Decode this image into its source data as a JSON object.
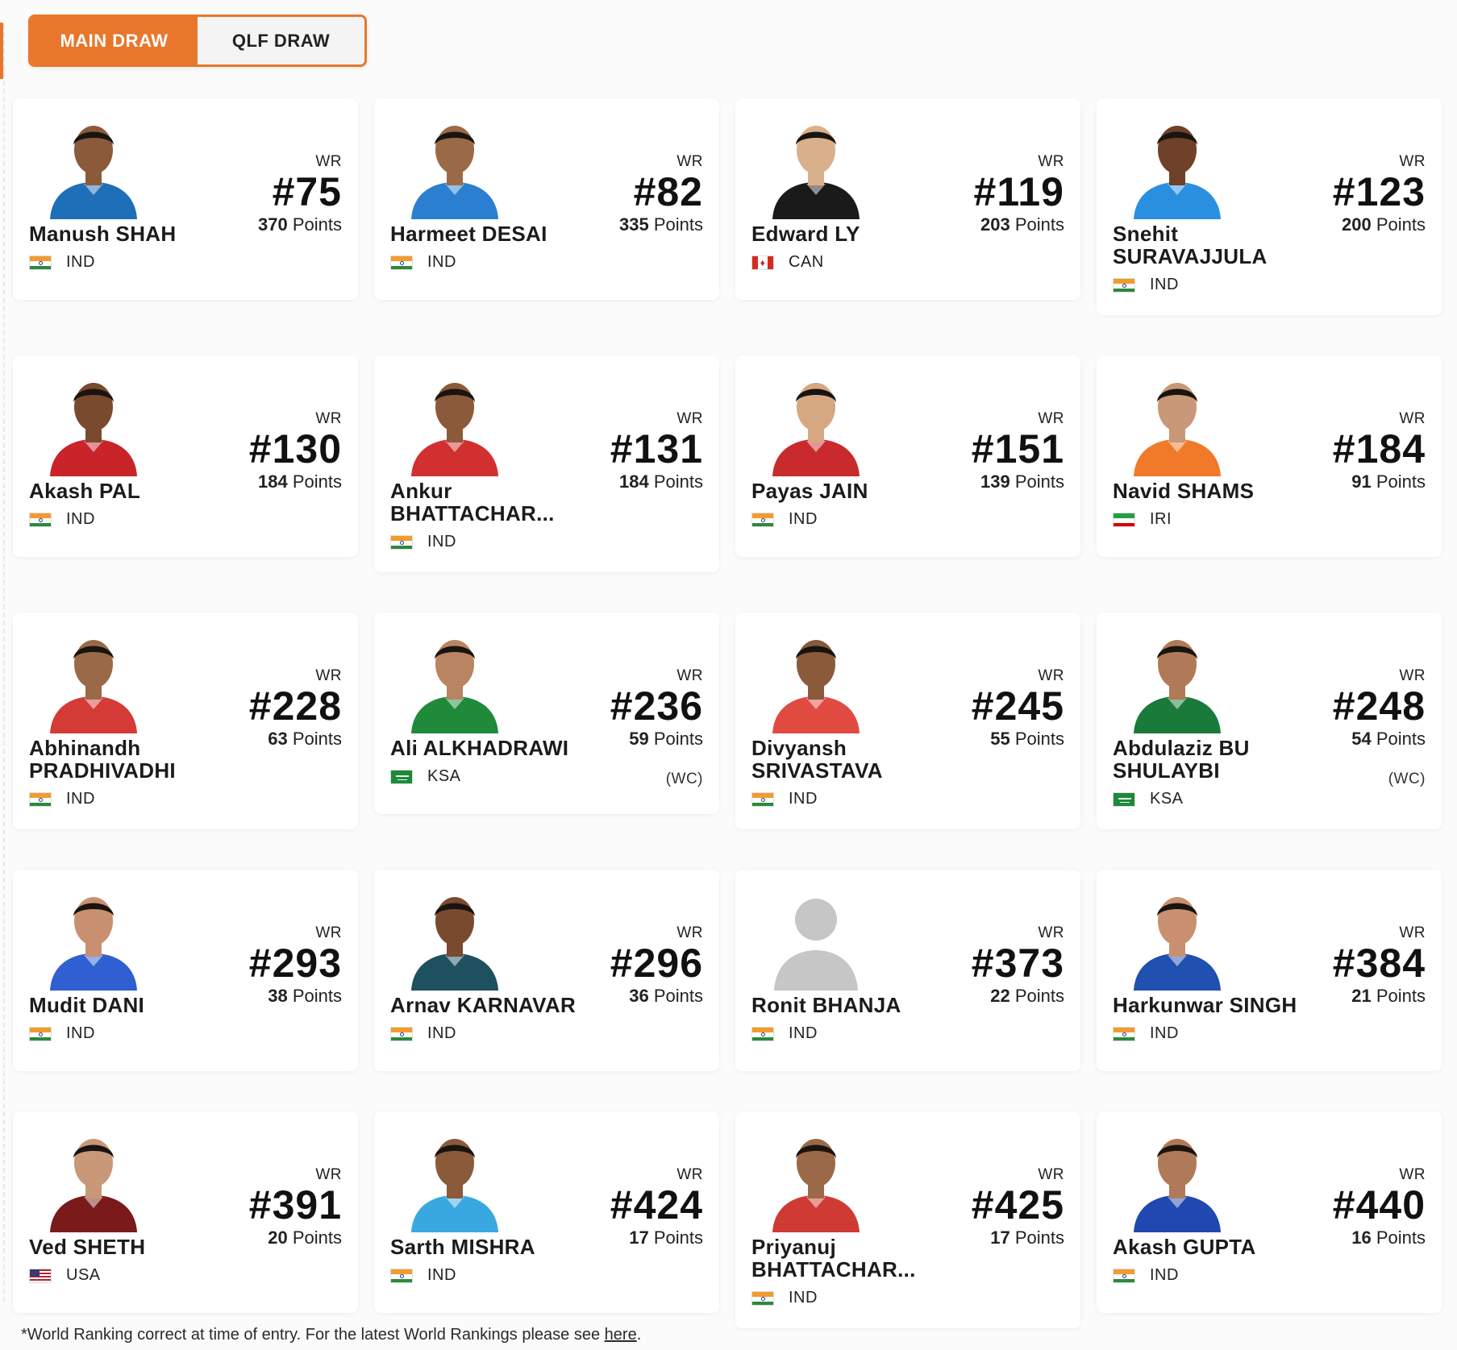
{
  "tabs": {
    "main_draw": "MAIN DRAW",
    "qlf_draw": "QLF DRAW",
    "active": "MAIN DRAW"
  },
  "wr_label": "WR",
  "points_word": "Points",
  "players": [
    {
      "name": "Manush SHAH",
      "country": "IND",
      "rank": "#75",
      "points": "370",
      "wc": "",
      "shirt": "#1e6fb8",
      "skin": "#8a5a3b"
    },
    {
      "name": "Harmeet DESAI",
      "country": "IND",
      "rank": "#82",
      "points": "335",
      "wc": "",
      "shirt": "#2a7fd0",
      "skin": "#9a6a48"
    },
    {
      "name": "Edward LY",
      "country": "CAN",
      "rank": "#119",
      "points": "203",
      "wc": "",
      "shirt": "#1a1a1a",
      "skin": "#d9b08c"
    },
    {
      "name": "Snehit SURAVAJJULA",
      "country": "IND",
      "rank": "#123",
      "points": "200",
      "wc": "",
      "shirt": "#2b8fe0",
      "skin": "#6e4128"
    },
    {
      "name": "Akash PAL",
      "country": "IND",
      "rank": "#130",
      "points": "184",
      "wc": "",
      "shirt": "#c8242a",
      "skin": "#7a4a2e"
    },
    {
      "name": "Ankur BHATTACHAR...",
      "country": "IND",
      "rank": "#131",
      "points": "184",
      "wc": "",
      "shirt": "#d23030",
      "skin": "#8a5a3b"
    },
    {
      "name": "Payas JAIN",
      "country": "IND",
      "rank": "#151",
      "points": "139",
      "wc": "",
      "shirt": "#c82a2e",
      "skin": "#d6a882"
    },
    {
      "name": "Navid SHAMS",
      "country": "IRI",
      "rank": "#184",
      "points": "91",
      "wc": "",
      "shirt": "#f07a2a",
      "skin": "#c89878"
    },
    {
      "name": "Abhinandh PRADHIVADHI",
      "country": "IND",
      "rank": "#228",
      "points": "63",
      "wc": "",
      "shirt": "#d43a36",
      "skin": "#9a6a48"
    },
    {
      "name": "Ali ALKHADRAWI",
      "country": "KSA",
      "rank": "#236",
      "points": "59",
      "wc": "(WC)",
      "shirt": "#1e8a3a",
      "skin": "#b88462"
    },
    {
      "name": "Divyansh SRIVASTAVA",
      "country": "IND",
      "rank": "#245",
      "points": "55",
      "wc": "",
      "shirt": "#e04a40",
      "skin": "#8a5a3b"
    },
    {
      "name": "Abdulaziz BU SHULAYBI",
      "country": "KSA",
      "rank": "#248",
      "points": "54",
      "wc": "(WC)",
      "shirt": "#1a7a3a",
      "skin": "#b07a58"
    },
    {
      "name": "Mudit DANI",
      "country": "IND",
      "rank": "#293",
      "points": "38",
      "wc": "",
      "shirt": "#2f5fd0",
      "skin": "#c89070"
    },
    {
      "name": "Arnav KARNAVAR",
      "country": "IND",
      "rank": "#296",
      "points": "36",
      "wc": "",
      "shirt": "#1e5060",
      "skin": "#7a4a2e"
    },
    {
      "name": "Ronit BHANJA",
      "country": "IND",
      "rank": "#373",
      "points": "22",
      "wc": "",
      "shirt": "#c8c8c8",
      "skin": "#c8c8c8"
    },
    {
      "name": "Harkunwar SINGH",
      "country": "IND",
      "rank": "#384",
      "points": "21",
      "wc": "",
      "shirt": "#2050b0",
      "skin": "#c89070"
    },
    {
      "name": "Ved SHETH",
      "country": "USA",
      "rank": "#391",
      "points": "20",
      "wc": "",
      "shirt": "#7a1a1a",
      "skin": "#c89878"
    },
    {
      "name": "Sarth MISHRA",
      "country": "IND",
      "rank": "#424",
      "points": "17",
      "wc": "",
      "shirt": "#3aa8e0",
      "skin": "#8a5a3b"
    },
    {
      "name": "Priyanuj BHATTACHAR...",
      "country": "IND",
      "rank": "#425",
      "points": "17",
      "wc": "",
      "shirt": "#d03a34",
      "skin": "#9a6a48"
    },
    {
      "name": "Akash GUPTA",
      "country": "IND",
      "rank": "#440",
      "points": "16",
      "wc": "",
      "shirt": "#2048b0",
      "skin": "#b07a58"
    }
  ],
  "footnote": {
    "text": "*World Ranking correct at time of entry. For the latest World Rankings please see ",
    "link": "here",
    "end": "."
  },
  "colors": {
    "accent": "#e8772c"
  }
}
